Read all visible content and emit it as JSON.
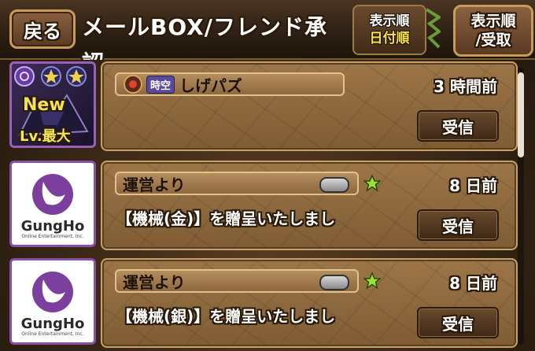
{
  "header": {
    "back_label": "戻る",
    "title": "メールBOX/フレンド承認",
    "sort_label": "表示順",
    "sort_value": "日付順",
    "receive_line1": "表示順",
    "receive_line2": "/受取"
  },
  "mails": [
    {
      "sender": "しげパズ",
      "badge": "時空",
      "time_num": "3",
      "time_unit": "時間前",
      "accept_label": "受信",
      "avatar": {
        "new_label": "New",
        "level_label": "Lv.最大"
      }
    },
    {
      "sender": "運営より",
      "time_num": "8",
      "time_unit": "日前",
      "message": "【機械(金)】を贈呈いたしまし",
      "accept_label": "受信",
      "avatar": {
        "logo_text": "GungHo",
        "logo_sub": "Online Entertainment, Inc."
      }
    },
    {
      "sender": "運営より",
      "time_num": "8",
      "time_unit": "日前",
      "message": "【機械(銀)】を贈呈いたしまし",
      "accept_label": "受信",
      "avatar": {
        "logo_text": "GungHo",
        "logo_sub": "Online Entertainment, Inc."
      }
    }
  ],
  "colors": {
    "star_green": "#9ee03a",
    "gungho_purple": "#7d3f9e",
    "frame_purple": "#9a5fb7"
  }
}
